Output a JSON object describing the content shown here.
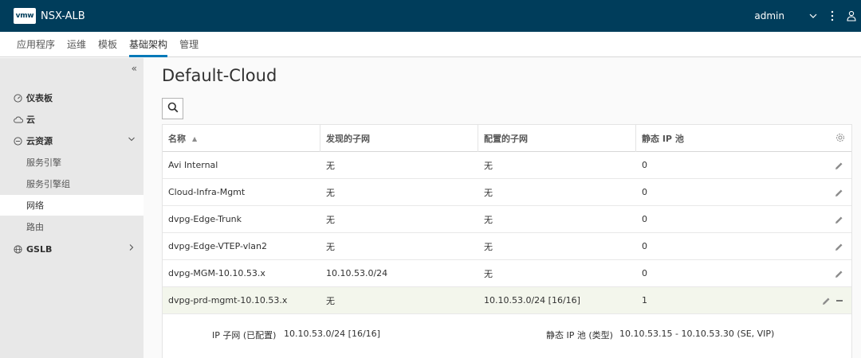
{
  "header": {
    "logo": "vmw",
    "app_name": "NSX-ALB",
    "user": "admin",
    "icons": [
      "chevron-down-icon",
      "more-vertical-icon",
      "user-icon"
    ]
  },
  "topnav": {
    "tabs": [
      {
        "label": "应用程序",
        "active": false
      },
      {
        "label": "运维",
        "active": false
      },
      {
        "label": "模板",
        "active": false
      },
      {
        "label": "基础架构",
        "active": true
      },
      {
        "label": "管理",
        "active": false
      }
    ]
  },
  "sidebar": {
    "collapse_glyph": "«",
    "items": [
      {
        "label": "仪表板",
        "icon": "dashboard-icon"
      },
      {
        "label": "云",
        "icon": "cloud-icon"
      },
      {
        "label": "云资源",
        "icon": "cloud-resources-icon",
        "expanded": true
      },
      {
        "label": "GSLB",
        "icon": "gslb-icon",
        "expanded": false
      }
    ],
    "subitems": [
      {
        "label": "服务引擎",
        "active": false
      },
      {
        "label": "服务引擎组",
        "active": false
      },
      {
        "label": "网络",
        "active": true
      },
      {
        "label": "路由",
        "active": false
      }
    ]
  },
  "main": {
    "title": "Default-Cloud",
    "columns": [
      "名称",
      "发现的子网",
      "配置的子网",
      "静态 IP 池"
    ],
    "rows": [
      {
        "name": "Avi Internal",
        "discovered": "无",
        "configured": "无",
        "static": "0"
      },
      {
        "name": "Cloud-Infra-Mgmt",
        "discovered": "无",
        "configured": "无",
        "static": "0"
      },
      {
        "name": "dvpg-Edge-Trunk",
        "discovered": "无",
        "configured": "无",
        "static": "0"
      },
      {
        "name": "dvpg-Edge-VTEP-vlan2",
        "discovered": "无",
        "configured": "无",
        "static": "0"
      },
      {
        "name": "dvpg-MGM-10.10.53.x",
        "discovered": "10.10.53.0/24",
        "configured": "无",
        "static": "0"
      },
      {
        "name": "dvpg-prd-mgmt-10.10.53.x",
        "discovered": "无",
        "configured": "10.10.53.0/24 [16/16]",
        "static": "1"
      }
    ],
    "detail": {
      "subnet_label": "IP 子网 (已配置)",
      "subnet_value": "10.10.53.0/24 [16/16]",
      "pool_label": "静态 IP 池 (类型)",
      "pool_value": "10.10.53.15 - 10.10.53.30 (SE, VIP)"
    }
  },
  "colors": {
    "header_bg": "#003d5b",
    "accent": "#0079b8",
    "sidebar_bg": "#e8e8e8",
    "selected_row": "#f3f6ec"
  }
}
